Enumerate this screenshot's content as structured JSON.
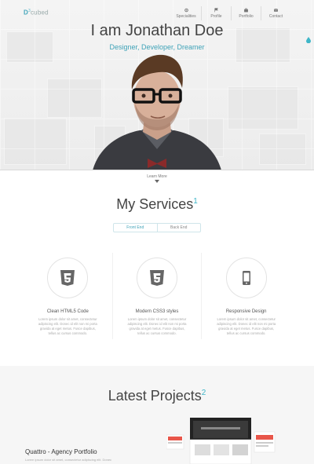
{
  "brand": {
    "logo_main": "D",
    "logo_sup": "3",
    "logo_rest": "cubed"
  },
  "nav": {
    "items": [
      {
        "label": "Specialities",
        "icon": "gear-icon"
      },
      {
        "label": "Profile",
        "icon": "flag-icon"
      },
      {
        "label": "Portfolio",
        "icon": "briefcase-icon"
      },
      {
        "label": "Contact",
        "icon": "envelope-icon"
      }
    ]
  },
  "hero": {
    "title": "I am Jonathan Doe",
    "subtitle": "Designer, Developer, Dreamer",
    "learn_more": "Learn More"
  },
  "services": {
    "title": "My Services",
    "number": "1",
    "tabs": [
      "Front End",
      "Back End"
    ],
    "cards": [
      {
        "icon": "html5-icon",
        "title": "Clean HTML5 Code",
        "text": "Lorem ipsum dolor sit amet, consectetur adipiscing elit. Donec id elit non mi porta gravida at eget metus. Fusce dapibus, tellus ac cursus commodo."
      },
      {
        "icon": "css3-icon",
        "title": "Modern CSS3 styles",
        "text": "Lorem ipsum dolor sit amet, consectetur adipiscing elit. Donec id elit non mi porta gravida at eget metus. Fusce dapibus, tellus ac cursus commodo."
      },
      {
        "icon": "mobile-icon",
        "title": "Responsive Design",
        "text": "Lorem ipsum dolor sit amet, consectetur adipiscing elit. Donec id elit non mi porta gravida at eget metus. Fusce dapibus, tellus ac cursus commodo."
      }
    ]
  },
  "projects": {
    "title": "Latest Projects",
    "number": "2",
    "item_title": "Quattro - Agency Portfolio",
    "item_desc": "Lorem ipsum dolor sit amet, consectetur adipiscing elit. Donec"
  },
  "colors": {
    "accent": "#3fa3b8",
    "text": "#444444",
    "muted": "#aaaaaa"
  }
}
